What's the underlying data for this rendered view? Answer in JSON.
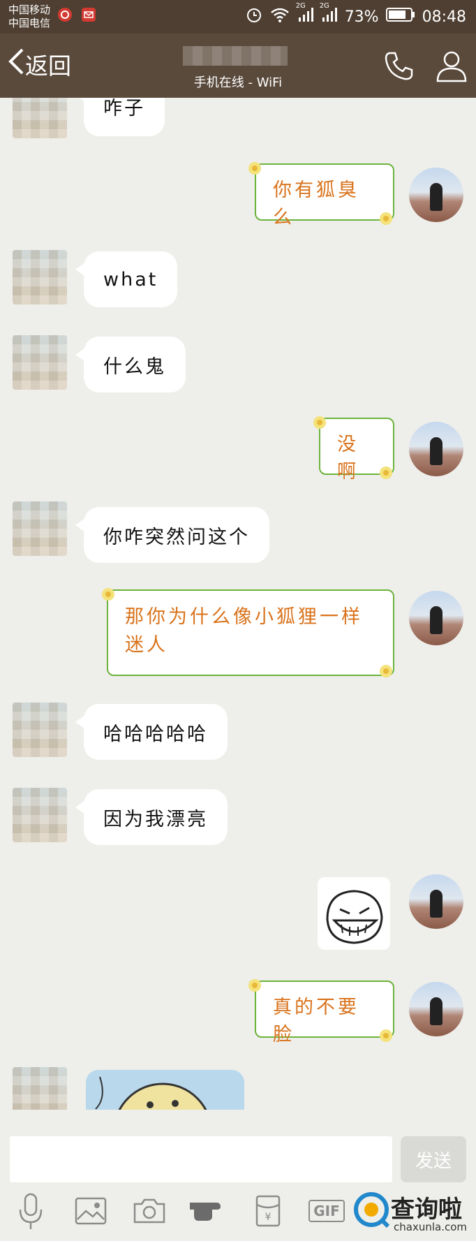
{
  "status_bar": {
    "carrier_1": "中国移动",
    "carrier_2": "中国电信",
    "network_1": "2G",
    "network_2": "2G",
    "battery": "73%",
    "time": "08:48"
  },
  "header": {
    "back_label": "返回",
    "status": "手机在线 - WiFi"
  },
  "messages": [
    {
      "side": "left",
      "text": "咋子"
    },
    {
      "side": "right",
      "text": "你有狐臭么"
    },
    {
      "side": "left",
      "text": "what"
    },
    {
      "side": "left",
      "text": "什么鬼"
    },
    {
      "side": "right",
      "text": "没啊"
    },
    {
      "side": "left",
      "text": "你咋突然问这个"
    },
    {
      "side": "right",
      "text": "那你为什么像小狐狸一样迷人"
    },
    {
      "side": "left",
      "text": "哈哈哈哈哈"
    },
    {
      "side": "left",
      "text": "因为我漂亮"
    },
    {
      "side": "right",
      "type": "sticker"
    },
    {
      "side": "right",
      "text": "真的不要脸"
    },
    {
      "side": "left",
      "type": "image"
    }
  ],
  "input": {
    "send_label": "发送"
  },
  "toolbar": {
    "gif_label": "GIF"
  },
  "watermark": {
    "text": "查询啦",
    "url": "chaxunla.com"
  },
  "colors": {
    "header_bg": "#5a4a3c",
    "status_bg": "#4e3f32",
    "bubble_border": "#6cb33b",
    "bubble_text": "#d9731c",
    "send_bg": "#d9d9d6"
  }
}
